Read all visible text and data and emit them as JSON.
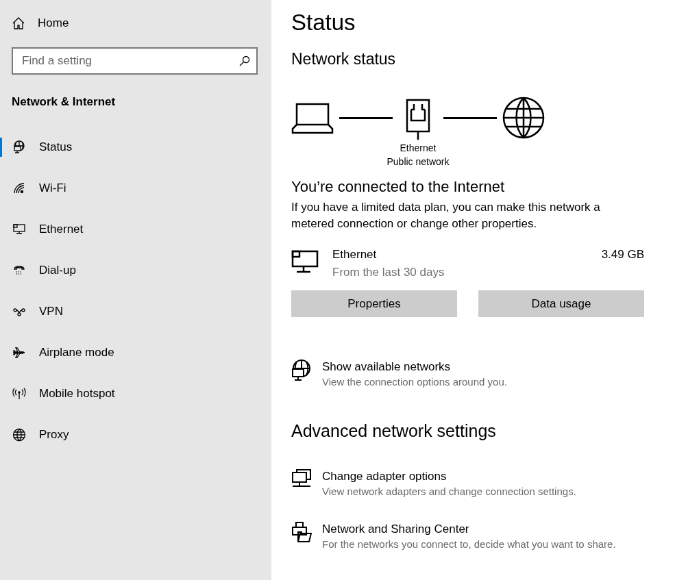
{
  "sidebar": {
    "home": "Home",
    "search": {
      "placeholder": "Find a setting"
    },
    "section_title": "Network & Internet",
    "items": [
      {
        "label": "Status",
        "selected": true
      },
      {
        "label": "Wi-Fi",
        "selected": false
      },
      {
        "label": "Ethernet",
        "selected": false
      },
      {
        "label": "Dial-up",
        "selected": false
      },
      {
        "label": "VPN",
        "selected": false
      },
      {
        "label": "Airplane mode",
        "selected": false
      },
      {
        "label": "Mobile hotspot",
        "selected": false
      },
      {
        "label": "Proxy",
        "selected": false
      }
    ]
  },
  "main": {
    "title": "Status",
    "network_status": {
      "heading": "Network status",
      "adapter_label": "Ethernet",
      "network_type": "Public network"
    },
    "connection": {
      "heading": "You’re connected to the Internet",
      "description": "If you have a limited data plan, you can make this network a metered connection or change other properties."
    },
    "usage": {
      "name": "Ethernet",
      "period": "From the last 30 days",
      "amount": "3.49 GB"
    },
    "buttons": [
      "Properties",
      "Data usage"
    ],
    "show_networks": {
      "title": "Show available networks",
      "description": "View the connection options around you."
    },
    "advanced": {
      "heading": "Advanced network settings",
      "links": [
        {
          "title": "Change adapter options",
          "description": "View network adapters and change connection settings."
        },
        {
          "title": "Network and Sharing Center",
          "description": "For the networks you connect to, decide what you want to share."
        }
      ]
    }
  }
}
